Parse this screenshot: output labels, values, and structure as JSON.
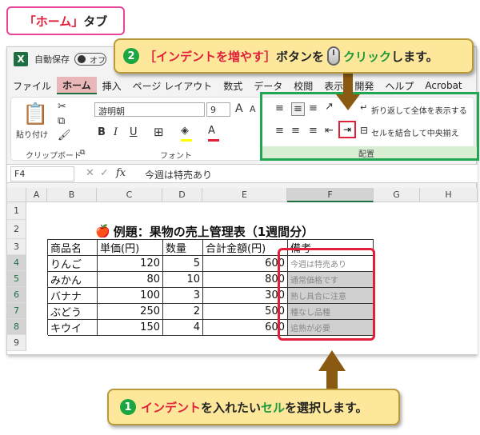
{
  "callouts": {
    "home_tab": {
      "bracket_open": "「",
      "name": "ホーム",
      "bracket_close": "」",
      "suffix": "タブ"
    },
    "step2": {
      "num": "2",
      "bracket": "［インデントを増やす］",
      "button": "ボタン",
      "wo": "を",
      "click": "クリック",
      "tail": "します。"
    },
    "step1": {
      "num": "1",
      "indent": "インデント",
      "mid": "を入れたい",
      "cell": "セル",
      "tail": "を選択します。"
    }
  },
  "titlebar": {
    "autosave_label": "自動保存",
    "toggle_state": "オフ",
    "logo": "X"
  },
  "menu": [
    "ファイル",
    "ホーム",
    "挿入",
    "ページ レイアウト",
    "数式",
    "データ",
    "校閲",
    "表示",
    "開発",
    "ヘルプ",
    "Acrobat"
  ],
  "ribbon": {
    "clipboard_label": "クリップボード",
    "paste_label": "貼り付け",
    "font_name": "游明朝",
    "font_size": "9",
    "font_label": "フォント",
    "wrap_text": "折り返して全体を表示する",
    "merge_center": "セルを結合して中央揃え",
    "alignment_label": "配置",
    "bold": "B",
    "italic": "I",
    "underline": "U",
    "grow_font": "A",
    "shrink_font": "A"
  },
  "formula_bar": {
    "name_box": "F4",
    "fx": "fx",
    "content": "今週は特売あり"
  },
  "grid": {
    "columns": [
      "A",
      "B",
      "C",
      "D",
      "E",
      "F",
      "G",
      "H"
    ],
    "rows": [
      "1",
      "2",
      "3",
      "4",
      "5",
      "6",
      "7",
      "8",
      "9"
    ],
    "title": "例題：果物の売上管理表（1週間分）",
    "headers": [
      "商品名",
      "単価(円)",
      "数量",
      "合計金額(円)",
      "備考"
    ],
    "data": [
      [
        "りんご",
        "120",
        "5",
        "600",
        "今週は特売あり"
      ],
      [
        "みかん",
        "80",
        "10",
        "800",
        "通常価格です"
      ],
      [
        "バナナ",
        "100",
        "3",
        "300",
        "熟し具合に注意"
      ],
      [
        "ぶどう",
        "250",
        "2",
        "500",
        "種なし品種"
      ],
      [
        "キウイ",
        "150",
        "4",
        "600",
        "追熟が必要"
      ]
    ]
  },
  "colors": {
    "accent_green": "#21a652",
    "accent_red": "#e0203a",
    "callout_bg": "#fde79b"
  }
}
